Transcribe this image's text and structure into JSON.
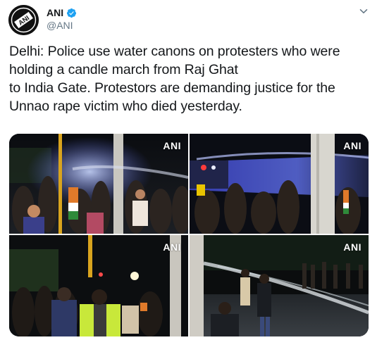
{
  "author": {
    "display_name": "ANI",
    "handle": "@ANI",
    "verified": true,
    "avatar_icon": "ani-logo-icon"
  },
  "menu_icon": "chevron-down-icon",
  "tweet": {
    "text": "Delhi: Police use water canons on protesters who were\nholding a candle march from Raj Ghat\nto India Gate. Protestors are demanding justice for the\nUnnao rape victim who died yesterday."
  },
  "media": {
    "photos": [
      {
        "watermark": "ANI"
      },
      {
        "watermark": "ANI"
      },
      {
        "watermark": "ANI"
      },
      {
        "watermark": "ANI"
      }
    ]
  },
  "colors": {
    "text": "#14171a",
    "secondary": "#657786",
    "verified": "#1da1f2",
    "water_cannon_light": "#4a58d6"
  }
}
